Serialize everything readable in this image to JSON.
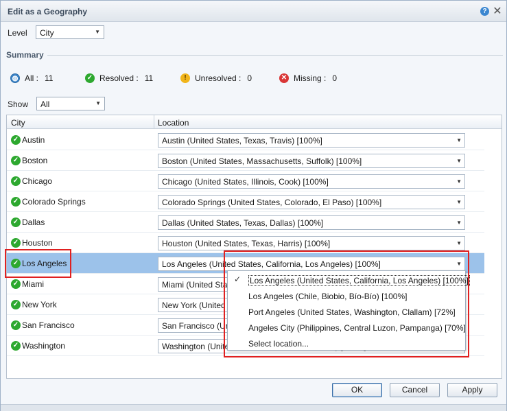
{
  "window": {
    "title": "Edit as a Geography"
  },
  "level": {
    "label": "Level",
    "value": "City"
  },
  "summary": {
    "title": "Summary",
    "all_label": "All :",
    "all_count": "11",
    "resolved_label": "Resolved :",
    "resolved_count": "11",
    "unresolved_label": "Unresolved :",
    "unresolved_count": "0",
    "missing_label": "Missing :",
    "missing_count": "0"
  },
  "show": {
    "label": "Show",
    "value": "All"
  },
  "grid": {
    "columns": [
      "City",
      "Location"
    ],
    "rows": [
      {
        "city": "Austin",
        "location": "Austin (United States, Texas, Travis) [100%]"
      },
      {
        "city": "Boston",
        "location": "Boston (United States, Massachusetts, Suffolk) [100%]"
      },
      {
        "city": "Chicago",
        "location": "Chicago (United States, Illinois, Cook) [100%]"
      },
      {
        "city": "Colorado Springs",
        "location": "Colorado Springs (United States, Colorado, El Paso) [100%]"
      },
      {
        "city": "Dallas",
        "location": "Dallas (United States, Texas, Dallas) [100%]"
      },
      {
        "city": "Houston",
        "location": "Houston (United States, Texas, Harris) [100%]"
      },
      {
        "city": "Los Angeles",
        "location": "Los Angeles (United States, California, Los Angeles) [100%]"
      },
      {
        "city": "Miami",
        "location": "Miami (United States, Florida, Miami-Dade) [100%]"
      },
      {
        "city": "New York",
        "location": "New York (United States, New York, New York) [100%]"
      },
      {
        "city": "San Francisco",
        "location": "San Francisco (United States, California, San Francisco) [100%]"
      },
      {
        "city": "Washington",
        "location": "Washington (United States, District of Columbia) [100%]"
      }
    ]
  },
  "dropdown": {
    "options": [
      "Los Angeles (United States, California, Los Angeles) [100%]",
      "Los Angeles (Chile, Biobio, Bío-Bío) [100%]",
      "Port Angeles (United States, Washington, Clallam) [72%]",
      "Angeles City (Philippines, Central Luzon, Pampanga) [70%]",
      "Select location..."
    ]
  },
  "buttons": {
    "ok": "OK",
    "cancel": "Cancel",
    "apply": "Apply"
  },
  "colors": {
    "resolved": "#2da82f",
    "selected_row": "#9cc2ea",
    "highlight": "#e02020"
  }
}
